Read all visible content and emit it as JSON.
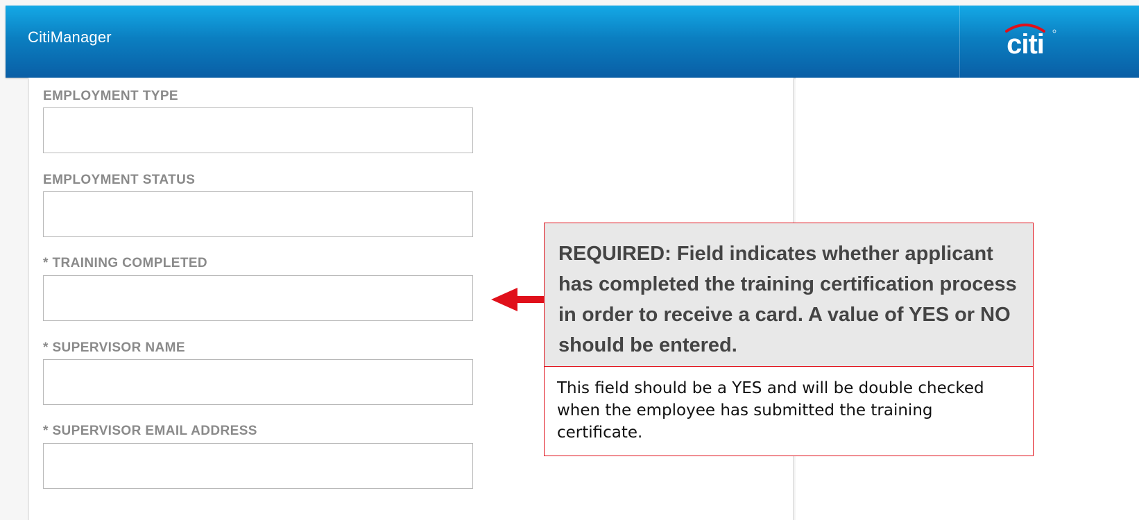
{
  "header": {
    "app_title": "CitiManager",
    "logo_text": "citi",
    "logo_icon": "citi-arc-logo",
    "brand_colors": {
      "header_top": "#14a9e6",
      "header_bottom": "#0a5ea5",
      "logo_arc": "#e0101a"
    }
  },
  "form": {
    "fields": [
      {
        "label": "EMPLOYMENT TYPE",
        "value": "",
        "required": false
      },
      {
        "label": "EMPLOYMENT STATUS",
        "value": "",
        "required": false
      },
      {
        "label": "* TRAINING COMPLETED",
        "value": "",
        "required": true
      },
      {
        "label": "* SUPERVISOR NAME",
        "value": "",
        "required": true
      },
      {
        "label": "* SUPERVISOR EMAIL ADDRESS",
        "value": "",
        "required": true
      }
    ]
  },
  "callout": {
    "heading": "REQUIRED: Field indicates whether applicant has completed the training certification process in order to receive a card. A value of YES or NO should be entered.",
    "note": "This field should be a YES and will be double checked when the employee has submitted the training certificate.",
    "pointer_icon": "left-arrow-icon",
    "accent_color": "#e0101a"
  }
}
